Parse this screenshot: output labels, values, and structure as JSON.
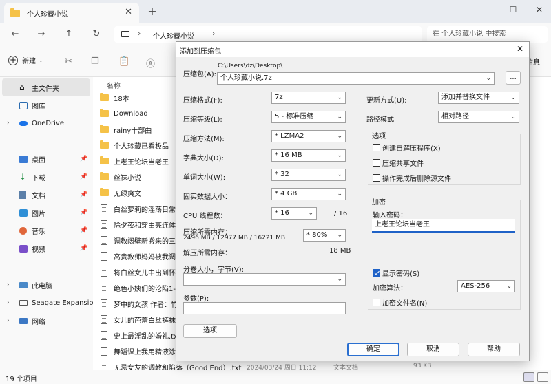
{
  "explorer": {
    "tab_title": "个人珍藏小说",
    "tab_close": "✕",
    "new_tab": "+",
    "window_controls": {
      "min": "—",
      "max": "☐",
      "close": "✕"
    },
    "nav": {
      "back": "←",
      "forward": "→",
      "up": "↑",
      "refresh": "↻"
    },
    "breadcrumb": "个人珍藏小说",
    "crumb_sep": "›",
    "search_placeholder": "在 个人珍藏小说 中搜索",
    "cmd": {
      "new_label": "新建",
      "right_label": "信息"
    },
    "sidebar": [
      {
        "label": "主文件夹",
        "pin": ""
      },
      {
        "label": "图库",
        "pin": ""
      },
      {
        "label": "OneDrive",
        "pin": ""
      },
      {
        "label": "桌面",
        "pin": "📌"
      },
      {
        "label": "下载",
        "pin": "📌"
      },
      {
        "label": "文档",
        "pin": "📌"
      },
      {
        "label": "图片",
        "pin": "📌"
      },
      {
        "label": "音乐",
        "pin": "📌"
      },
      {
        "label": "视频",
        "pin": "📌"
      },
      {
        "label": "此电脑",
        "pin": ""
      },
      {
        "label": "Seagate Expansion",
        "pin": ""
      },
      {
        "label": "网络",
        "pin": ""
      }
    ],
    "column_name": "名称",
    "files": [
      "18本",
      "Download",
      "rainy十部曲",
      "个人珍藏已看极品",
      "上老王论坛当老王",
      "丝袜小说",
      "无绿爽文",
      "白丝萝莉的淫荡日常.txt",
      "除夕夜和穿由亮连体丝袜",
      "调教阔壁新搬来的三妻",
      "高贵教师妈妈被我调教",
      "将白丝女儿中出到怀孕",
      "绝色小姨们的沦陷1-2",
      "梦中的女孩 作者：竹叶",
      "女儿的芭蕾白丝裤袜.txt",
      "史上最淫乱的婚礼.txt",
      "舞蹈课上我用精液涂满",
      "无忌女友的调教和陷落（Good End）.txt"
    ],
    "last_row_date": "2024/03/24 周日 11:12",
    "last_row_type": "文本文档",
    "last_row_size": "93 KB",
    "status_count": "19 个项目"
  },
  "dialog": {
    "title": "添加到压缩包",
    "close": "✕",
    "archive_label": "压缩包(A):",
    "archive_path": "C:\\Users\\dz\\Desktop\\",
    "archive_name": "个人珍藏小说.7z",
    "browse": "...",
    "format_label": "压缩格式(F):",
    "format_value": "7z",
    "level_label": "压缩等级(L):",
    "level_value": "5 - 标准压缩",
    "method_label": "压缩方法(M):",
    "method_value": "* LZMA2",
    "dict_label": "字典大小(D):",
    "dict_value": "* 16 MB",
    "word_label": "单词大小(W):",
    "word_value": "* 32",
    "solid_label": "固实数据大小：",
    "solid_value": "* 4 GB",
    "threads_label": "CPU 线程数：",
    "threads_value": "* 16",
    "threads_max": "/ 16",
    "mem_comp_label": "压缩所需内存：",
    "mem_comp_value": "2496 MB / 12977 MB / 16221 MB",
    "mem_pct": "* 80%",
    "mem_decomp_label": "解压所需内存：",
    "mem_decomp_value": "18 MB",
    "split_label": "分卷大小，字节(V):",
    "split_value": "",
    "params_label": "参数(P):",
    "params_value": "",
    "options_btn": "选项",
    "update_label": "更新方式(U):",
    "update_value": "添加并替换文件",
    "pathmode_label": "路径模式",
    "pathmode_value": "相对路径",
    "opts_group": "选项",
    "opt_sfx": "创建自解压程序(X)",
    "opt_shared": "压缩共享文件",
    "opt_delete": "操作完成后删除源文件",
    "enc_group": "加密",
    "pwd_label": "输入密码：",
    "pwd_value": "上老王论坛当老王",
    "show_pwd": "显示密码(S)",
    "enc_method_label": "加密算法：",
    "enc_method_value": "AES-256",
    "enc_names": "加密文件名(N)",
    "ok": "确定",
    "cancel": "取消",
    "help": "帮助"
  }
}
